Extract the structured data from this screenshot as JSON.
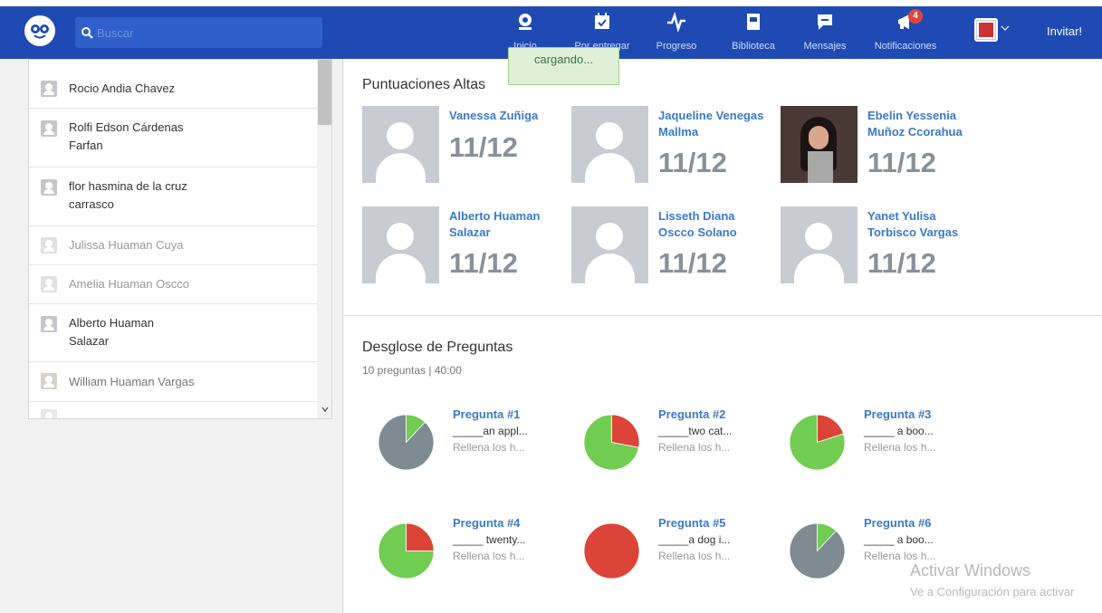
{
  "search": {
    "placeholder": "Buscar"
  },
  "nav": [
    {
      "label": "Inicio",
      "icon": "home-icon"
    },
    {
      "label": "Por entregar",
      "icon": "calendar-check-icon"
    },
    {
      "label": "Progreso",
      "icon": "pulse-icon"
    },
    {
      "label": "Biblioteca",
      "icon": "book-icon"
    },
    {
      "label": "Mensajes",
      "icon": "chat-icon"
    },
    {
      "label": "Notificaciones",
      "icon": "megaphone-icon",
      "badge": "4"
    }
  ],
  "invite_label": "Invitar!",
  "loading_text": "cargando...",
  "students": [
    {
      "name": "Rocio Andia Chavez"
    },
    {
      "name": "Rolfi Edson Cárdenas Farfan"
    },
    {
      "name": "flor hasmina de la cruz carrasco"
    },
    {
      "name": "Julissa Huaman Cuya"
    },
    {
      "name": "Amelia Huaman Oscco"
    },
    {
      "name": "Alberto Huaman Salazar"
    },
    {
      "name": "William Huaman Vargas"
    }
  ],
  "high_scores": {
    "title": "Puntuaciones Altas",
    "cards": [
      {
        "name": "Vanessa Zuñiga",
        "score": "11/12"
      },
      {
        "name": "Jaqueline Venegas Mallma",
        "score": "11/12"
      },
      {
        "name": "Ebelin Yessenia Muñoz Ccorahua",
        "score": "11/12"
      },
      {
        "name": "Alberto Huaman Salazar",
        "score": "11/12"
      },
      {
        "name": "Lisseth Diana Oscco Solano",
        "score": "11/12"
      },
      {
        "name": "Yanet Yulisa Torbisco Vargas",
        "score": "11/12"
      }
    ]
  },
  "breakdown": {
    "title": "Desglose de Preguntas",
    "subtitle": "10 preguntas | 40:00",
    "questions": [
      {
        "title": "Pregunta #1",
        "text": "_____an appl...",
        "type": "Rellena los h...",
        "correct": 0.12,
        "incorrect": 0.0,
        "unanswered": 0.88
      },
      {
        "title": "Pregunta #2",
        "text": "_____two cat...",
        "type": "Rellena los h...",
        "correct": 0.72,
        "incorrect": 0.28,
        "unanswered": 0.0
      },
      {
        "title": "Pregunta #3",
        "text": "_____ a boo...",
        "type": "Rellena los h...",
        "correct": 0.8,
        "incorrect": 0.2,
        "unanswered": 0.0
      },
      {
        "title": "Pregunta #4",
        "text": "_____ twenty...",
        "type": "Rellena los h...",
        "correct": 0.75,
        "incorrect": 0.25,
        "unanswered": 0.0
      },
      {
        "title": "Pregunta #5",
        "text": "_____a dog i...",
        "type": "Rellena los h...",
        "correct": 0.0,
        "incorrect": 1.0,
        "unanswered": 0.0
      },
      {
        "title": "Pregunta #6",
        "text": "_____ a boo...",
        "type": "Rellena los h...",
        "correct": 0.12,
        "incorrect": 0.0,
        "unanswered": 0.88
      }
    ]
  },
  "colors": {
    "correct": "#71cc52",
    "incorrect": "#db4436",
    "unanswered": "#7f8b93",
    "brand": "#1f4ab3"
  },
  "watermark": {
    "line1": "Activar Windows",
    "line2": "Ve a Configuración para activar"
  }
}
